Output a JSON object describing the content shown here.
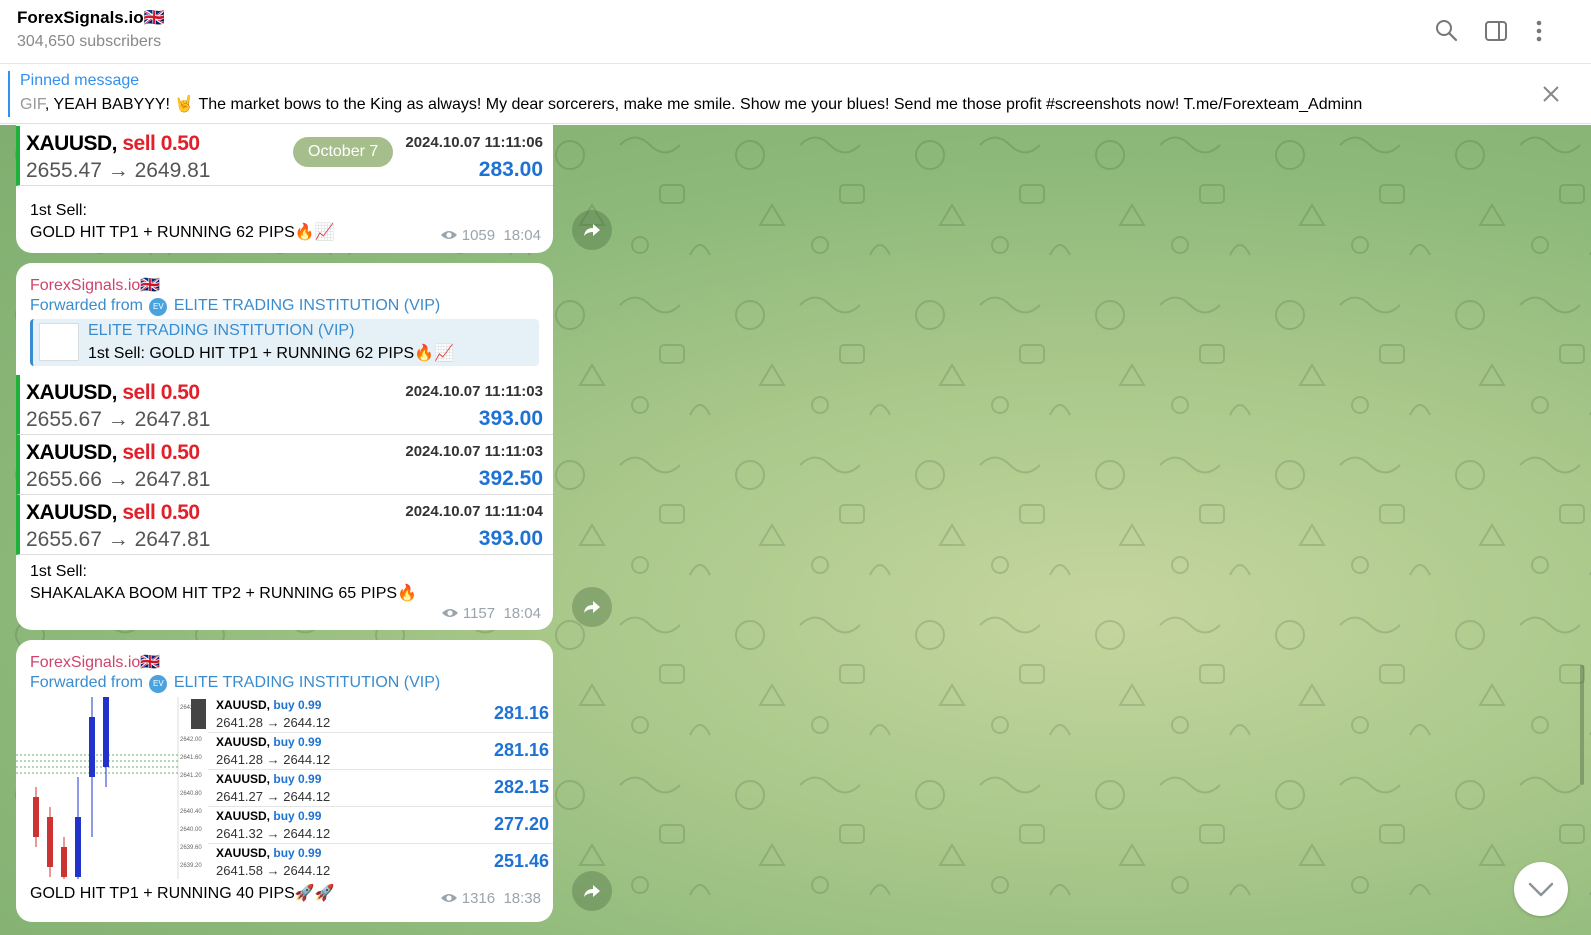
{
  "header": {
    "title": "ForexSignals.io🇬🇧",
    "subscribers": "304,650 subscribers",
    "icons": [
      "search-icon",
      "sidebar-toggle-icon",
      "more-vert-icon"
    ]
  },
  "pinned": {
    "label": "Pinned message",
    "gif": "GIF",
    "text": ", YEAH BABYYY! 🤘  The market bows to the King as always! My dear sorcerers, make me smile. Show me your blues!  Send me those profit #screenshots now!  T.me/Forexteam_Adminn"
  },
  "date_pill": "October 7",
  "messages": [
    {
      "trades": [
        {
          "symbol": "XAUUSD,",
          "action": "sell 0.50",
          "prices": "2655.47 → 2649.81",
          "time": "2024.10.07 11:11:06",
          "profit": "283.00"
        }
      ],
      "text_line1": "1st Sell:",
      "text_line2": "GOLD HIT TP1 + RUNNING 62 PIPS🔥📈",
      "views": "1059",
      "time": "18:04"
    },
    {
      "sender": "ForexSignals.io🇬🇧",
      "forwarded_label": "Forwarded from",
      "forwarded_from": "ELITE TRADING INSTITUTION (VIP)",
      "quote_title": "ELITE TRADING INSTITUTION (VIP)",
      "quote_text": "1st Sell: GOLD HIT TP1 + RUNNING 62 PIPS🔥📈",
      "trades": [
        {
          "symbol": "XAUUSD,",
          "action": "sell 0.50",
          "prices": "2655.67 → 2647.81",
          "time": "2024.10.07 11:11:03",
          "profit": "393.00"
        },
        {
          "symbol": "XAUUSD,",
          "action": "sell 0.50",
          "prices": "2655.66 → 2647.81",
          "time": "2024.10.07 11:11:03",
          "profit": "392.50"
        },
        {
          "symbol": "XAUUSD,",
          "action": "sell 0.50",
          "prices": "2655.67 → 2647.81",
          "time": "2024.10.07 11:11:04",
          "profit": "393.00"
        }
      ],
      "text_line1": "1st Sell:",
      "text_line2": "SHAKALAKA BOOM HIT TP2 + RUNNING 65 PIPS🔥",
      "views": "1157",
      "time": "18:04"
    },
    {
      "sender": "ForexSignals.io🇬🇧",
      "forwarded_label": "Forwarded from",
      "forwarded_from": "ELITE TRADING INSTITUTION (VIP)",
      "mini_trades": [
        {
          "symbol": "XAUUSD,",
          "action": "buy 0.99",
          "prices": "2641.28 → 2644.12",
          "profit": "281.16"
        },
        {
          "symbol": "XAUUSD,",
          "action": "buy 0.99",
          "prices": "2641.28 → 2644.12",
          "profit": "281.16"
        },
        {
          "symbol": "XAUUSD,",
          "action": "buy 0.99",
          "prices": "2641.27 → 2644.12",
          "profit": "282.15"
        },
        {
          "symbol": "XAUUSD,",
          "action": "buy 0.99",
          "prices": "2641.32 → 2644.12",
          "profit": "277.20"
        },
        {
          "symbol": "XAUUSD,",
          "action": "buy 0.99",
          "prices": "2641.58 → 2644.12",
          "profit": "251.46"
        }
      ],
      "text": "GOLD HIT TP1 + RUNNING 40 PIPS🚀🚀",
      "views": "1316",
      "time": "18:38"
    }
  ],
  "colors": {
    "accent": "#3390ec",
    "sell": "#e0202a",
    "profit": "#1e72d3",
    "sender": "#d0436c",
    "trade_border": "#1fb13a"
  }
}
